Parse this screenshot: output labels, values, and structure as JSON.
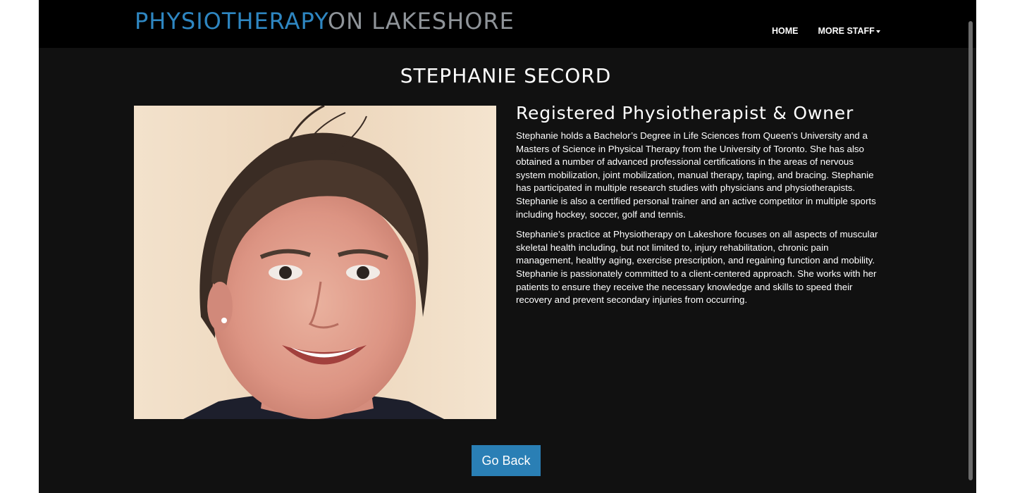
{
  "brand": {
    "part1": "PHYSIOTHERAPY",
    "part2": "ON LAKESHORE",
    "color_primary": "#2e86c1",
    "color_secondary": "#8f9499"
  },
  "nav": {
    "home": "HOME",
    "more_staff": "MORE STAFF"
  },
  "profile": {
    "name": "STEPHANIE SECORD",
    "role": "Registered Physiotherapist & Owner",
    "photo_icon": "portrait-photo",
    "bio": [
      "Stephanie holds a Bachelor’s Degree in Life Sciences from Queen’s University and a Masters of Science in Physical Therapy from the University of Toronto. She has also obtained a number of advanced professional certifications in the areas of nervous system mobilization, joint mobilization, manual therapy, taping, and bracing. Stephanie has participated in multiple research studies with physicians and physiotherapists. Stephanie is also a certified personal trainer and an active competitor in multiple sports including hockey, soccer, golf and tennis.",
      "Stephanie’s practice at Physiotherapy on Lakeshore focuses on all aspects of muscular skeletal health including, but not limited to, injury rehabilitation, chronic pain management, healthy aging, exercise prescription, and regaining function and mobility. Stephanie is passionately committed to a client-centered approach. She works with her patients to ensure they receive the necessary knowledge and skills to speed their recovery and prevent secondary injuries from occurring."
    ]
  },
  "actions": {
    "go_back": "Go Back",
    "button_color": "#2a7fb5"
  }
}
